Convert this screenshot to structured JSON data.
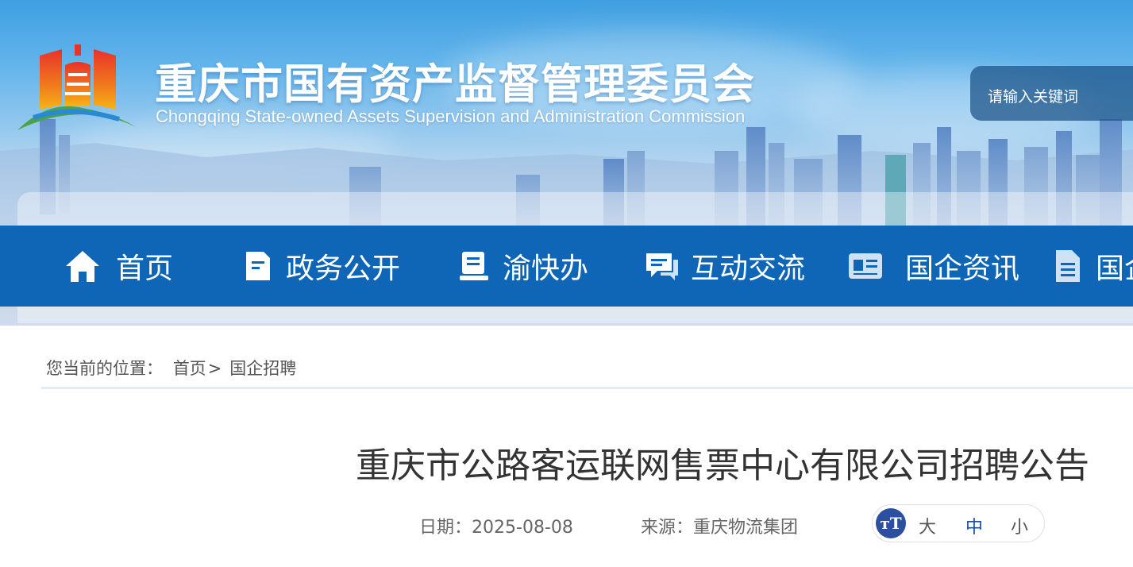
{
  "header": {
    "title_cn": "重庆市国有资产监督管理委员会",
    "title_en": "Chongqing State-owned Assets Supervision and Administration Commission",
    "search_placeholder": "请输入关键词"
  },
  "nav": {
    "items": [
      {
        "label": "首页",
        "icon": "home-icon"
      },
      {
        "label": "政务公开",
        "icon": "document-icon"
      },
      {
        "label": "渝快办",
        "icon": "service-icon"
      },
      {
        "label": "互动交流",
        "icon": "chat-icon"
      },
      {
        "label": "国企资讯",
        "icon": "news-icon"
      },
      {
        "label": "国企",
        "icon": "file-icon"
      }
    ]
  },
  "breadcrumb": {
    "prefix": "您当前的位置：",
    "home": "首页",
    "separator": ">",
    "current": "国企招聘"
  },
  "article": {
    "title": "重庆市公路客运联网售票中心有限公司招聘公告",
    "date_label": "日期：",
    "date": "2025-08-08",
    "source_label": "来源：",
    "source": "重庆物流集团"
  },
  "font_size": {
    "large": "大",
    "medium": "中",
    "small": "小",
    "selected": "中"
  },
  "colors": {
    "nav_bg": "#0f65b6",
    "font_icon_bg": "#2c4f9f"
  }
}
